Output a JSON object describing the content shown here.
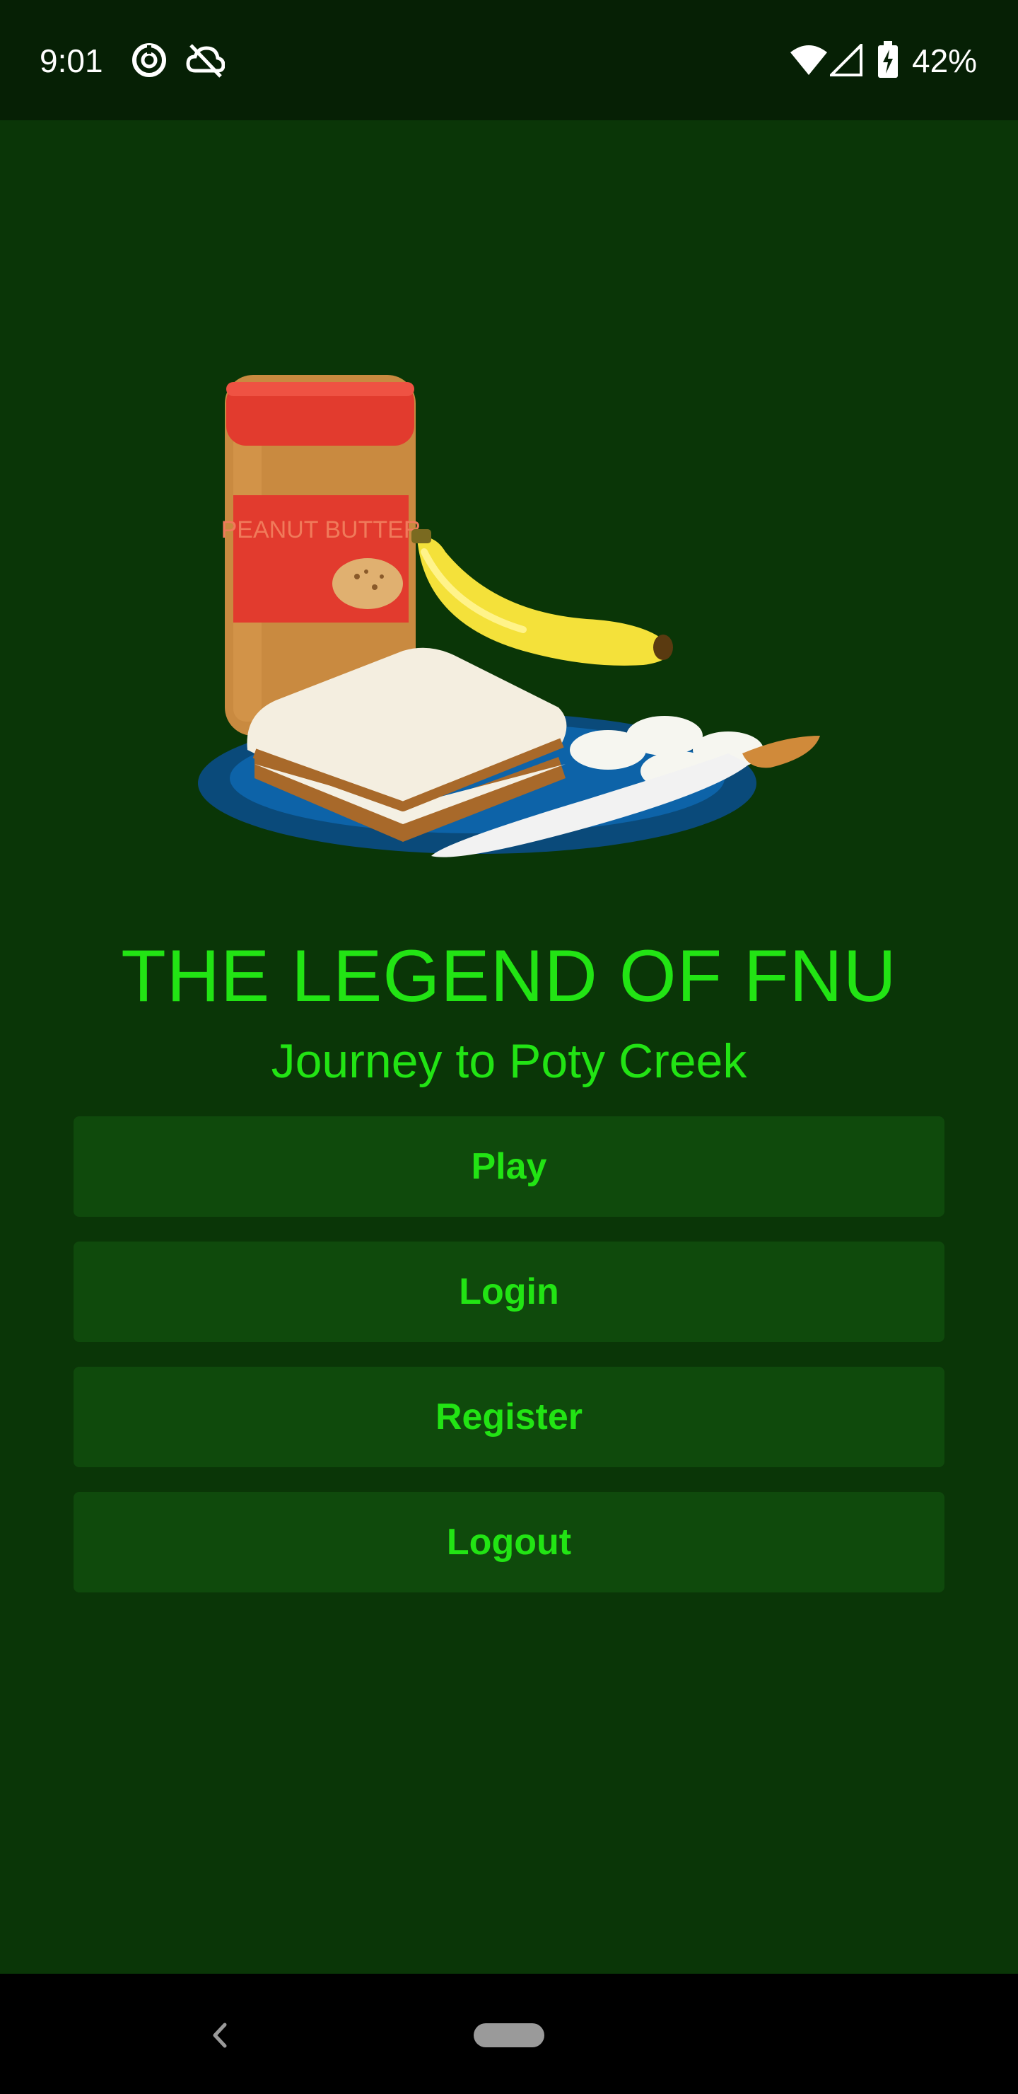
{
  "status_bar": {
    "time": "9:01",
    "battery": "42%",
    "icons": [
      "data-saver-icon",
      "sync-off-icon",
      "wifi-icon",
      "cell-signal-icon",
      "battery-charging-icon"
    ]
  },
  "game": {
    "title": "THE LEGEND OF FNU",
    "subtitle": "Journey to Poty Creek",
    "jar_label": "PEANUT BUTTER"
  },
  "menu": {
    "buttons": [
      {
        "label": "Play"
      },
      {
        "label": "Login"
      },
      {
        "label": "Register"
      },
      {
        "label": "Logout"
      }
    ]
  },
  "colors": {
    "background": "#0a3607",
    "status_bar": "#062005",
    "accent_text": "#22e414",
    "button_bg": "#0f4a0c"
  },
  "nav_bar": {
    "icons": [
      "back-icon",
      "home-pill-icon"
    ]
  }
}
